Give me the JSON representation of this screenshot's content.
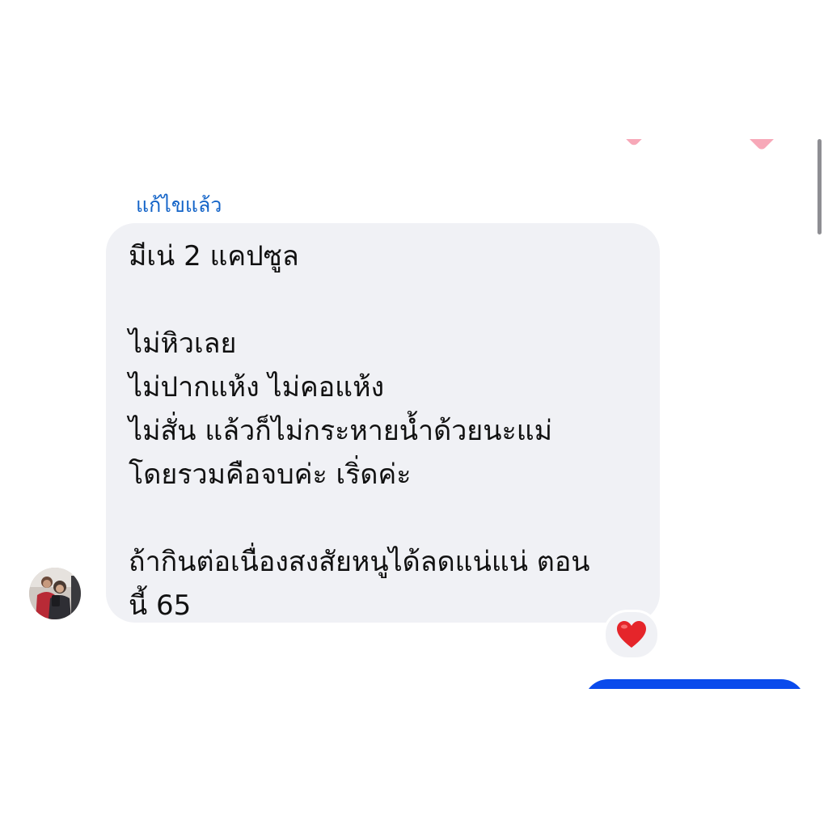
{
  "message": {
    "edited_label": "แก้ไขแล้ว",
    "lines": [
      "มีเน่ 2 แคปซูล",
      "",
      "ไม่หิวเลย",
      "ไม่ปากแห้ง ไม่คอแห้ง",
      "ไม่สั่น แล้วก็ไม่กระหายน้ำด้วยนะแม่",
      "โดยรวมคือจบค่ะ  เริ่ดค่ะ",
      "",
      "ถ้ากินต่อเนื่องสงสัยหนูได้ลดแน่แน่ ตอน",
      "นี้ 65"
    ],
    "reaction": "heart"
  },
  "icons": {
    "reaction_icon": "red-heart-icon",
    "avatar_icon": "avatar-photo"
  },
  "colors": {
    "edited_label": "#1464c8",
    "incoming_bubble": "#f0f1f5",
    "outgoing_bubble": "#0a4bec",
    "heart": "#e5252a",
    "partial_heart": "#f7a8b8"
  }
}
